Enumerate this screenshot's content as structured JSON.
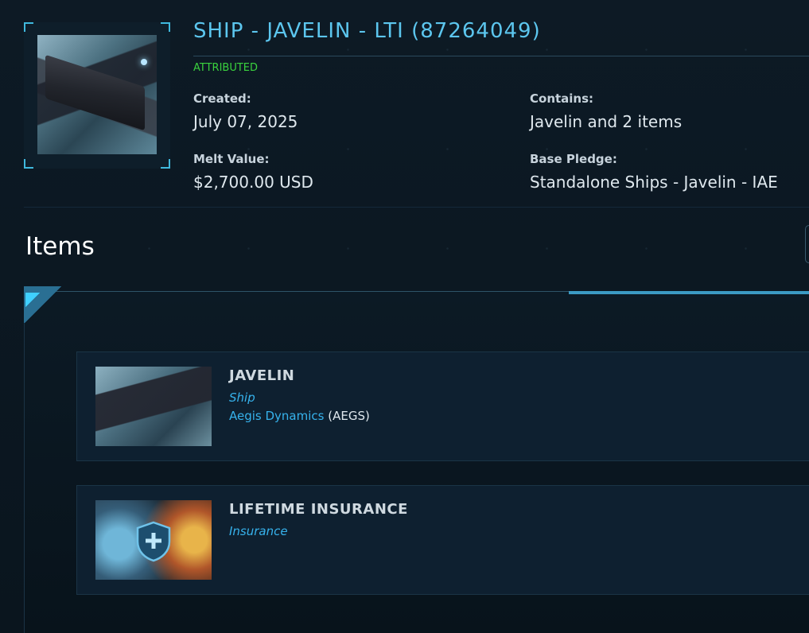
{
  "pledge": {
    "title": "SHIP - JAVELIN - LTI (87264049)",
    "status": "ATTRIBUTED",
    "created_label": "Created:",
    "created_value": "July 07, 2025",
    "contains_label": "Contains:",
    "contains_value": "Javelin and 2 items",
    "melt_label": "Melt Value:",
    "melt_value": "$2,700.00 USD",
    "base_label": "Base Pledge:",
    "base_value": "Standalone Ships - Javelin - IAE"
  },
  "items_section": {
    "heading": "Items",
    "items": [
      {
        "name": "JAVELIN",
        "type": "Ship",
        "manufacturer": "Aegis Dynamics",
        "manufacturer_code": "AEGS",
        "icon": "ship-thumbnail"
      },
      {
        "name": "LIFETIME INSURANCE",
        "type": "Insurance",
        "icon": "insurance-shield-icon"
      }
    ]
  },
  "colors": {
    "accent": "#5cc6ee",
    "status_green": "#3ad23e",
    "link_blue": "#36b2ec",
    "background": "#0b1620"
  }
}
